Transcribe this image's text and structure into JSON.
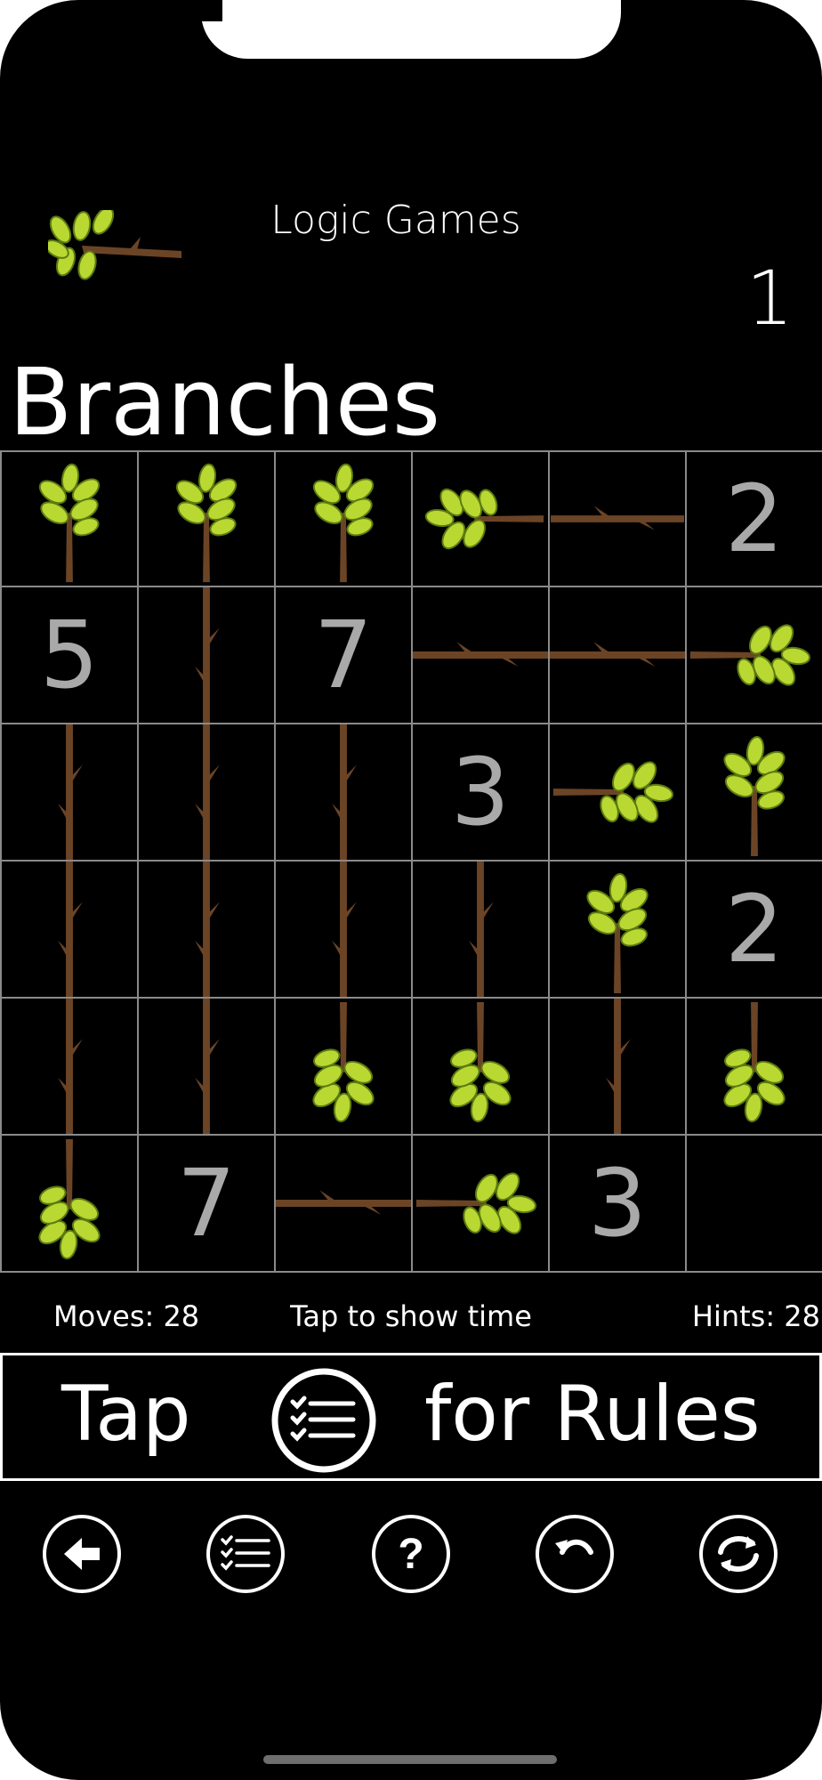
{
  "header": {
    "app_title": "Logic Games",
    "level_number": "1",
    "logo_icon": "leafy-branch-icon"
  },
  "puzzle": {
    "title": "Branches",
    "rows": 6,
    "cols": 6,
    "colors": {
      "bark": "#6b4426",
      "leaf": "#b9d832",
      "grid": "#8a8a8a",
      "number": "#a9a9a9"
    },
    "cells": [
      [
        {
          "t": "tip",
          "d": "up"
        },
        {
          "t": "tip",
          "d": "up"
        },
        {
          "t": "tip",
          "d": "up"
        },
        {
          "t": "tip",
          "d": "left"
        },
        {
          "t": "h"
        },
        {
          "t": "n",
          "v": "2"
        }
      ],
      [
        {
          "t": "n",
          "v": "5"
        },
        {
          "t": "v"
        },
        {
          "t": "n",
          "v": "7"
        },
        {
          "t": "h"
        },
        {
          "t": "h"
        },
        {
          "t": "tip",
          "d": "right"
        }
      ],
      [
        {
          "t": "v"
        },
        {
          "t": "v"
        },
        {
          "t": "v"
        },
        {
          "t": "n",
          "v": "3"
        },
        {
          "t": "tip",
          "d": "right"
        },
        {
          "t": "tip",
          "d": "up"
        }
      ],
      [
        {
          "t": "v"
        },
        {
          "t": "v"
        },
        {
          "t": "v"
        },
        {
          "t": "v"
        },
        {
          "t": "tip",
          "d": "up"
        },
        {
          "t": "n",
          "v": "2"
        }
      ],
      [
        {
          "t": "v"
        },
        {
          "t": "v"
        },
        {
          "t": "tip",
          "d": "down"
        },
        {
          "t": "tip",
          "d": "down"
        },
        {
          "t": "v"
        },
        {
          "t": "tip",
          "d": "down"
        }
      ],
      [
        {
          "t": "tip",
          "d": "down"
        },
        {
          "t": "n",
          "v": "7"
        },
        {
          "t": "h"
        },
        {
          "t": "tip",
          "d": "right"
        },
        {
          "t": "n",
          "v": "3"
        },
        {
          "t": "e"
        }
      ]
    ]
  },
  "stats": {
    "moves": "Moves: 28",
    "timer": "Tap to show time",
    "hints": "Hints: 28"
  },
  "rules_bar": {
    "prefix": "Tap",
    "suffix": "for Rules",
    "icon": "checklist-icon"
  },
  "toolbar": [
    {
      "name": "back-button",
      "icon": "arrow-left-icon"
    },
    {
      "name": "rules-button",
      "icon": "checklist-icon"
    },
    {
      "name": "help-button",
      "icon": "question-icon"
    },
    {
      "name": "undo-button",
      "icon": "undo-icon"
    },
    {
      "name": "restart-button",
      "icon": "refresh-icon"
    }
  ]
}
